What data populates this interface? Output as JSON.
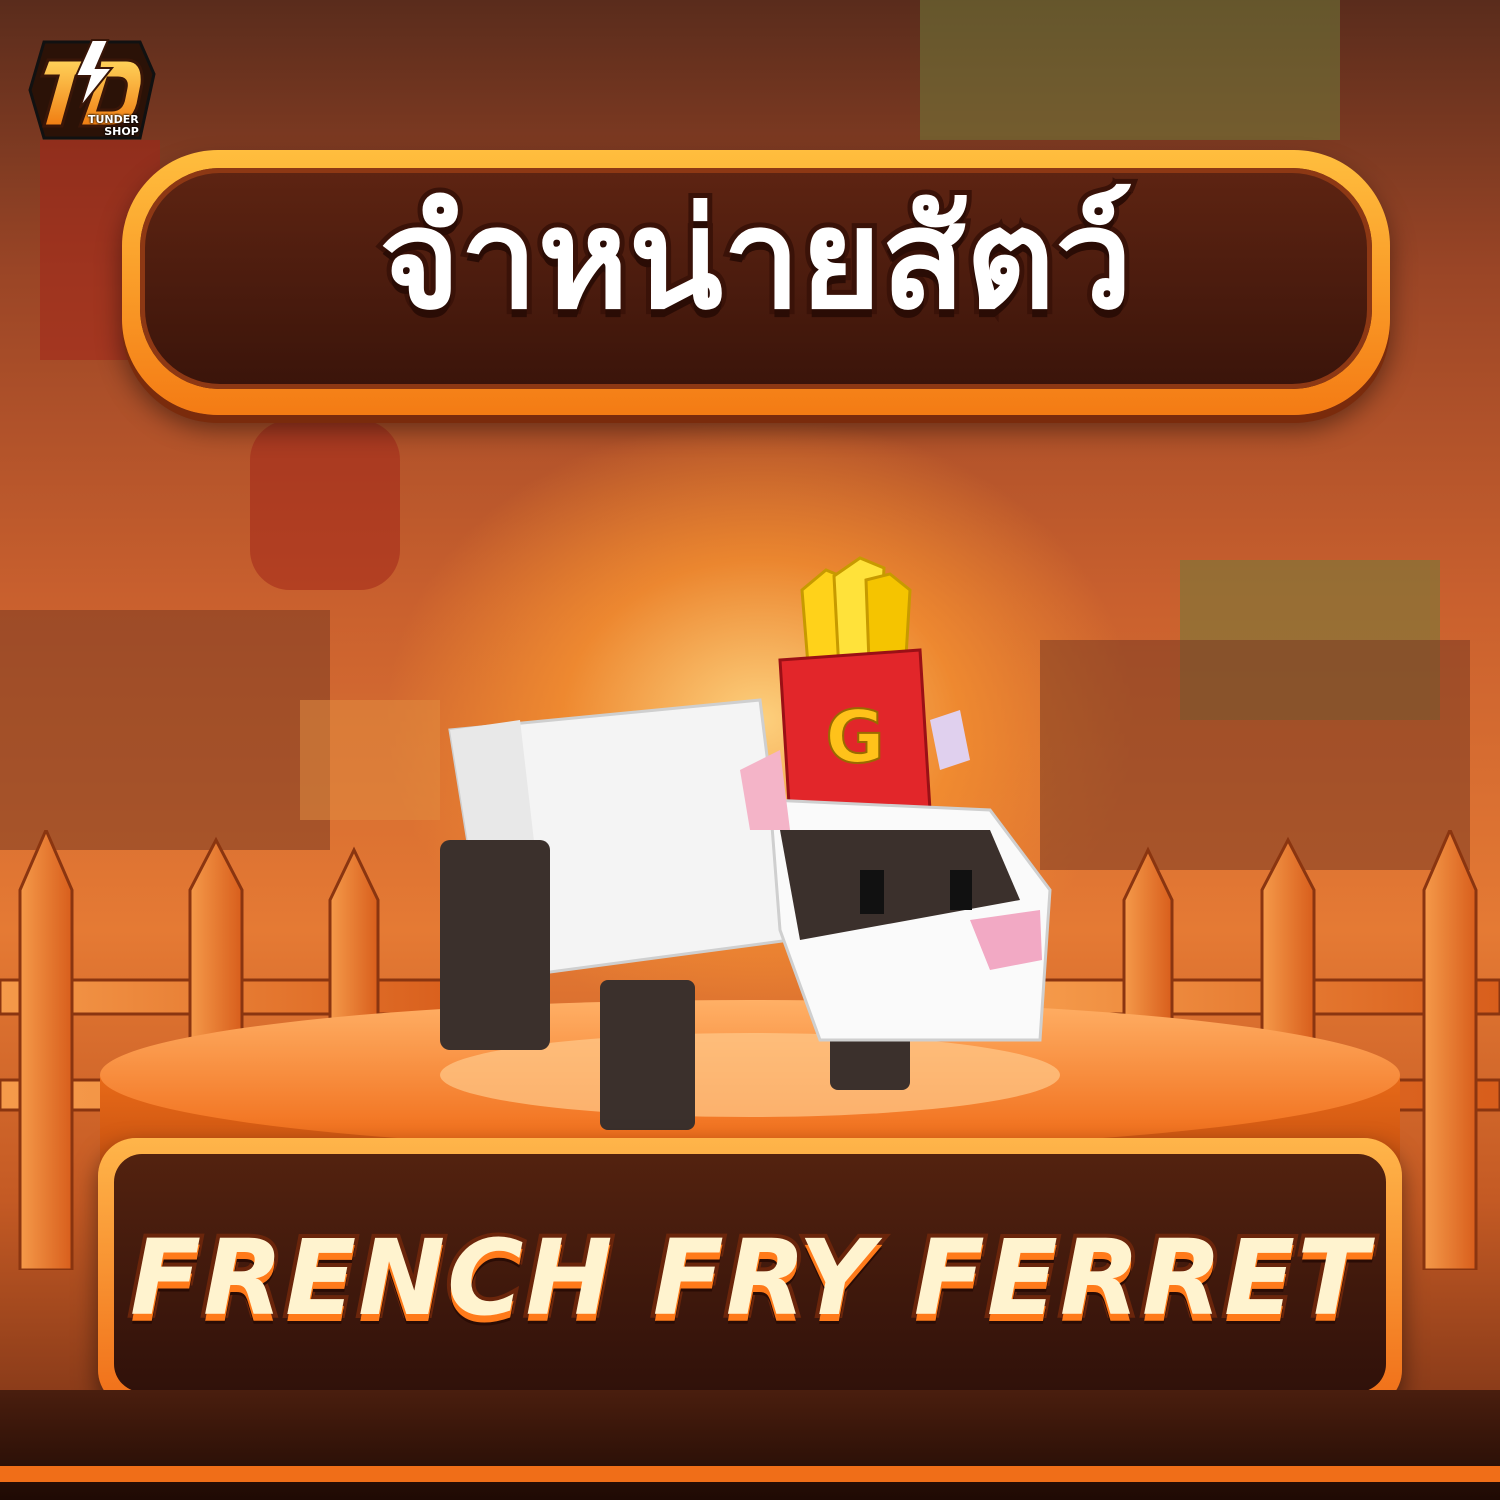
{
  "logo": {
    "monogram": "TD",
    "line1": "TUNDER",
    "line2": "SHOP",
    "icon": "lightning-logo-icon"
  },
  "banner": {
    "title": "จำหน่ายสัตว์"
  },
  "product": {
    "name": "FRENCH FRY FERRET",
    "fry_box_letter": "G",
    "icon": "ferret-pet-icon"
  },
  "colors": {
    "accent": "#f47b14",
    "banner_dark": "#3a140a",
    "gold": "#ffbe3e"
  }
}
